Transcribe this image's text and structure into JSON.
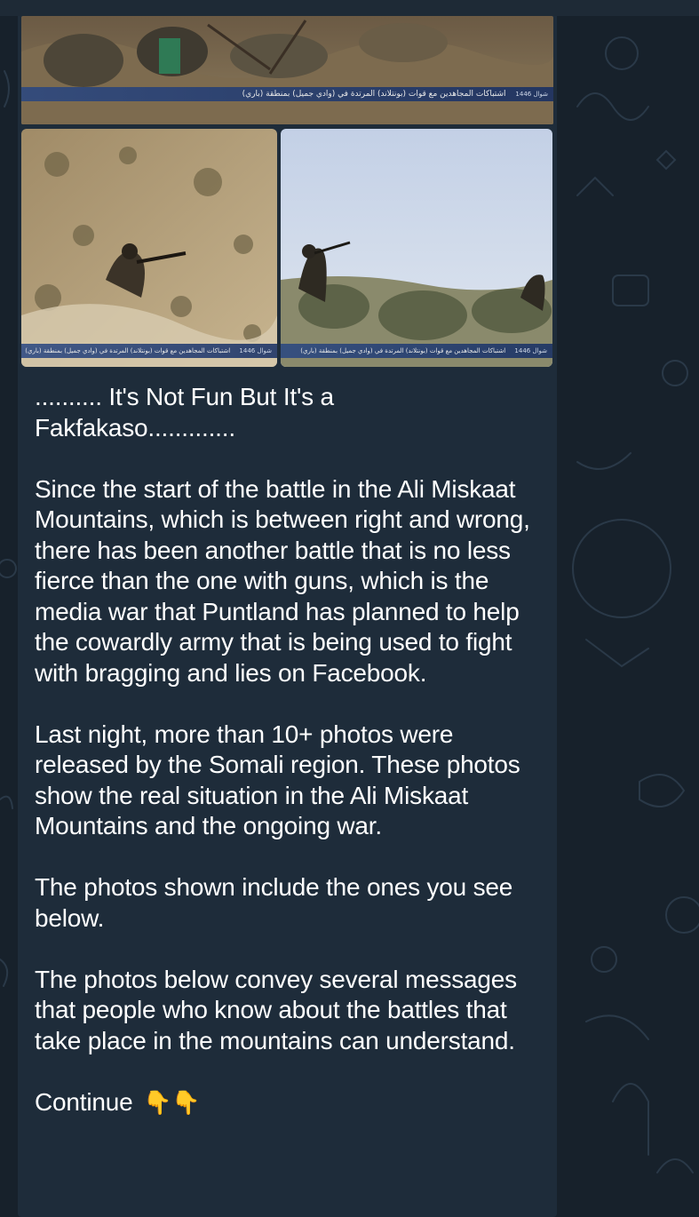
{
  "message": {
    "photos": [
      {
        "caption": "اشتباكات المجاهدين مع قوات (بونتلاند) المرتدة في (وادي جميل) بمنطقة (باري)",
        "tag": "شوال 1446"
      },
      {
        "caption": "اشتباكات المجاهدين مع قوات (بونتلاند) المرتدة في (وادي جميل) بمنطقة (باري)",
        "tag": "شوال 1446"
      },
      {
        "caption": "اشتباكات المجاهدين مع قوات (بونتلاند) المرتدة في (وادي جميل) بمنطقة (باري)",
        "tag": "شوال 1446"
      }
    ],
    "title_line1": ".......... It's Not Fun But It's a",
    "title_line2": "Fakfakaso.............",
    "para1": "Since the start of the battle in the Ali Miskaat Mountains, which is between right and wrong, there has been another battle that is no less fierce than the one with guns, which is the media war that Puntland has planned to help the cowardly army that is being used to fight with bragging and lies on Facebook.",
    "para2": "Last night, more than 10+ photos were released by the Somali region. These photos show the real situation in the Ali Miskaat Mountains and the ongoing war.",
    "para3": "The photos shown include the ones you see below.",
    "para4": "The photos below convey several messages that people who know about the battles that take place in the mountains can understand.",
    "continue_label": "Continue",
    "continue_emoji": "👇👇"
  },
  "colors": {
    "background": "#17212b",
    "bubble": "#1e2c3a",
    "text": "#ffffff"
  }
}
